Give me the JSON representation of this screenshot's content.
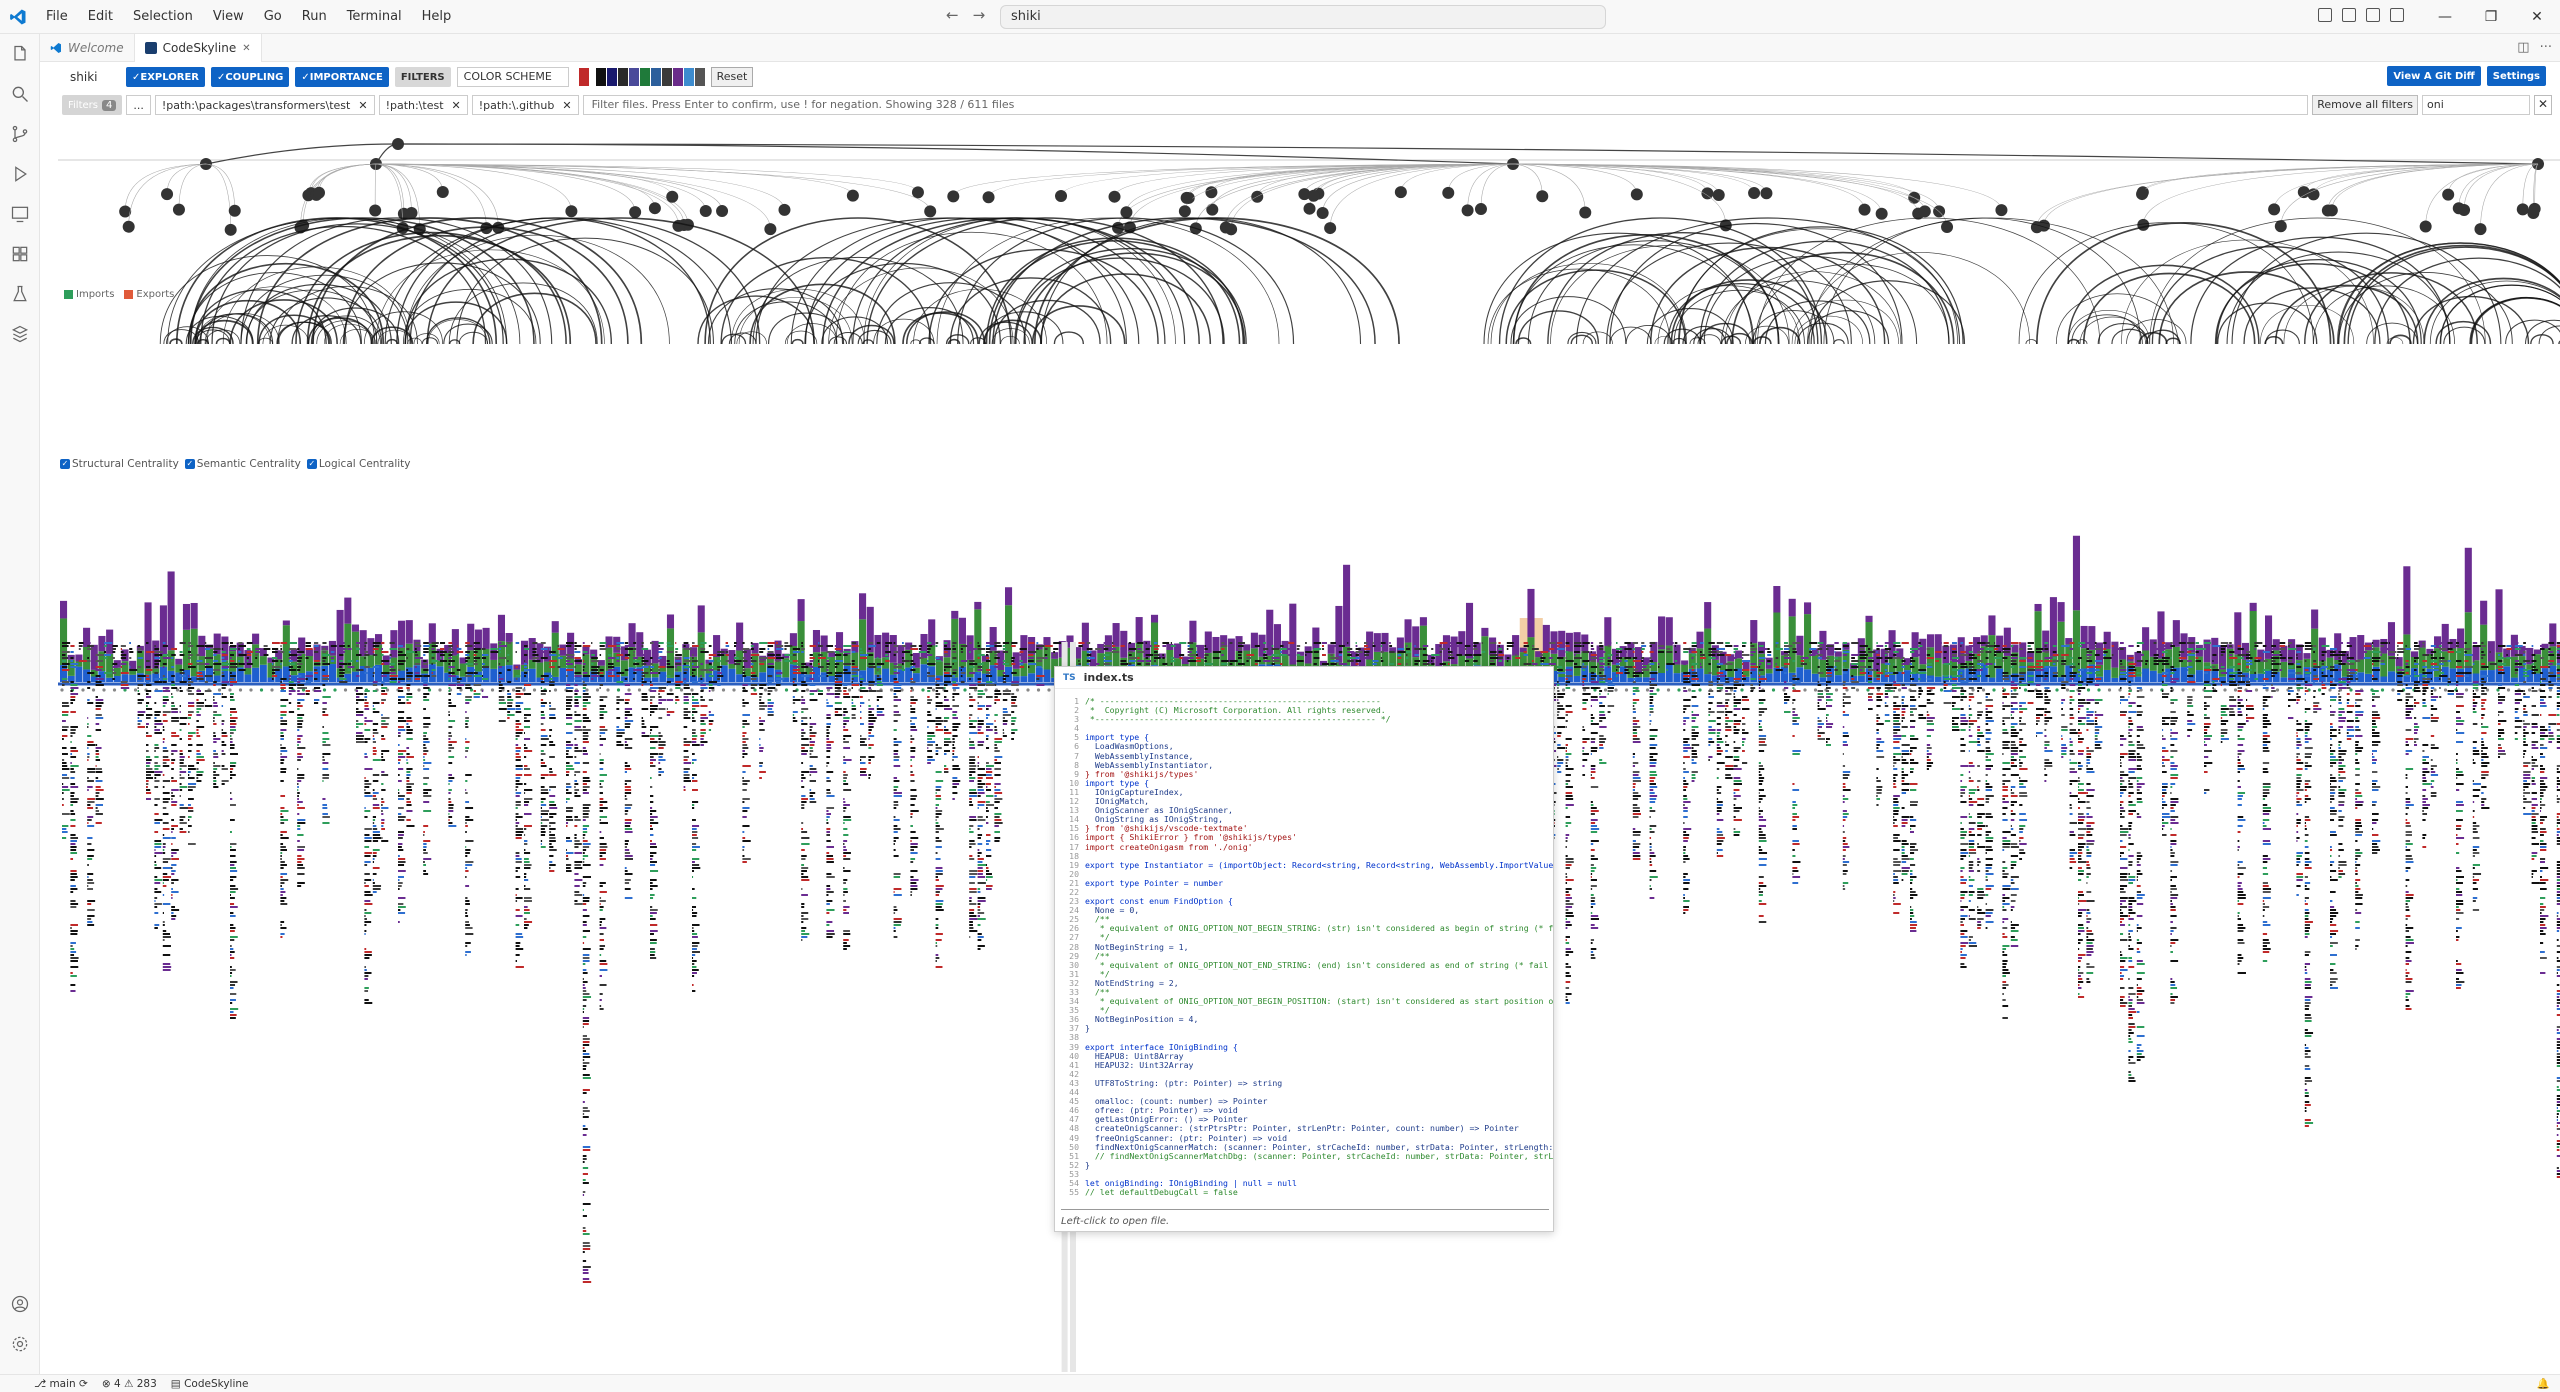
{
  "titlebar": {
    "menu": [
      "File",
      "Edit",
      "Selection",
      "View",
      "Go",
      "Run",
      "Terminal",
      "Help"
    ],
    "command_center": "shiki",
    "nav_back": "←",
    "nav_forward": "→",
    "win_minimize": "—",
    "win_restore": "❐",
    "win_close": "✕"
  },
  "tabs": [
    {
      "label": "Welcome",
      "state": "inactive"
    },
    {
      "label": "CodeSkyline",
      "state": "active",
      "close": "✕"
    }
  ],
  "tab_actions": {
    "split": "◫",
    "more": "···"
  },
  "toolbar": {
    "repo": "shiki",
    "explorer": "✓EXPLORER",
    "coupling": "✓COUPLING",
    "importance": "✓IMPORTANCE",
    "filters_btn": "FILTERS",
    "color_scheme": "COLOR SCHEME",
    "reset": "Reset",
    "git_diff": "View A Git Diff",
    "settings": "Settings",
    "swatches": [
      "#c02a2a",
      "#111111",
      "#1a1a6e",
      "#2a2a2a",
      "#4a4a9a",
      "#1f7a3a",
      "#2c5f9c",
      "#3a3a3a",
      "#6a2c8a",
      "#3d8ccf",
      "#555555"
    ]
  },
  "filterbar": {
    "filters_label": "Filters",
    "filters_count": "4",
    "ellipsis": "...",
    "chips": [
      {
        "label": "!path:\\packages\\transformers\\test",
        "close": "✕"
      },
      {
        "label": "!path:\\test",
        "close": "✕"
      },
      {
        "label": "!path:\\.github",
        "close": "✕"
      }
    ],
    "input_placeholder": "Filter files. Press Enter to confirm, use ! for negation. Showing 328 / 611 files",
    "remove_all": "Remove all filters",
    "search_value": "oni",
    "clear": "✕"
  },
  "legend_io": {
    "imports": "Imports",
    "imports_color": "#2e9e5b",
    "exports": "Exports",
    "exports_color": "#e05a3a"
  },
  "centrality_legend": {
    "structural": "Structural Centrality",
    "semantic": "Semantic Centrality",
    "logical": "Logical Centrality",
    "check": "✓"
  },
  "colors": {
    "structural": "#1f5fcf",
    "semantic": "#3a8f3a",
    "logical": "#6a2c91",
    "highlight": "#f3cfa6",
    "accent": "#0e63c5"
  },
  "popup": {
    "filename": "index.ts",
    "footer": "Left-click to open file.",
    "lines": [
      {
        "n": "1",
        "t": "/* ---------------------------------------------------------",
        "c": "cm"
      },
      {
        "n": "2",
        "t": " *  Copyright (C) Microsoft Corporation. All rights reserved.",
        "c": "cm"
      },
      {
        "n": "3",
        "t": " *--------------------------------------------------------- */",
        "c": "cm"
      },
      {
        "n": "4",
        "t": "",
        "c": ""
      },
      {
        "n": "5",
        "t": "import type {",
        "c": "kw"
      },
      {
        "n": "6",
        "t": "  LoadWasmOptions,",
        "c": ""
      },
      {
        "n": "7",
        "t": "  WebAssemblyInstance,",
        "c": ""
      },
      {
        "n": "8",
        "t": "  WebAssemblyInstantiator,",
        "c": ""
      },
      {
        "n": "9",
        "t": "} from '@shikijs/types'",
        "c": "str"
      },
      {
        "n": "10",
        "t": "import type {",
        "c": "kw"
      },
      {
        "n": "11",
        "t": "  IOnigCaptureIndex,",
        "c": ""
      },
      {
        "n": "12",
        "t": "  IOnigMatch,",
        "c": ""
      },
      {
        "n": "13",
        "t": "  OnigScanner as IOnigScanner,",
        "c": ""
      },
      {
        "n": "14",
        "t": "  OnigString as IOnigString,",
        "c": ""
      },
      {
        "n": "15",
        "t": "} from '@shikijs/vscode-textmate'",
        "c": "str"
      },
      {
        "n": "16",
        "t": "import { ShikiError } from '@shikijs/types'",
        "c": "str"
      },
      {
        "n": "17",
        "t": "import createOnigasm from './onig'",
        "c": "str"
      },
      {
        "n": "18",
        "t": "",
        "c": ""
      },
      {
        "n": "19",
        "t": "export type Instantiator = (importObject: Record<string, Record<string, WebAssembly.ImportValue>>) => Promise<WebAssemblyInstance>",
        "c": "kw"
      },
      {
        "n": "20",
        "t": "",
        "c": ""
      },
      {
        "n": "21",
        "t": "export type Pointer = number",
        "c": "kw"
      },
      {
        "n": "22",
        "t": "",
        "c": ""
      },
      {
        "n": "23",
        "t": "export const enum FindOption {",
        "c": "kw"
      },
      {
        "n": "24",
        "t": "  None = 0,",
        "c": ""
      },
      {
        "n": "25",
        "t": "  /**",
        "c": "cm"
      },
      {
        "n": "26",
        "t": "   * equivalent of ONIG_OPTION_NOT_BEGIN_STRING: (str) isn't considered as begin of string (* fail \\A)",
        "c": "cm"
      },
      {
        "n": "27",
        "t": "   */",
        "c": "cm"
      },
      {
        "n": "28",
        "t": "  NotBeginString = 1,",
        "c": ""
      },
      {
        "n": "29",
        "t": "  /**",
        "c": "cm"
      },
      {
        "n": "30",
        "t": "   * equivalent of ONIG_OPTION_NOT_END_STRING: (end) isn't considered as end of string (* fail \\z, \\Z)",
        "c": "cm"
      },
      {
        "n": "31",
        "t": "   */",
        "c": "cm"
      },
      {
        "n": "32",
        "t": "  NotEndString = 2,",
        "c": ""
      },
      {
        "n": "33",
        "t": "  /**",
        "c": "cm"
      },
      {
        "n": "34",
        "t": "   * equivalent of ONIG_OPTION_NOT_BEGIN_POSITION: (start) isn't considered as start position of search (* fail \\G)",
        "c": "cm"
      },
      {
        "n": "35",
        "t": "   */",
        "c": "cm"
      },
      {
        "n": "36",
        "t": "  NotBeginPosition = 4,",
        "c": ""
      },
      {
        "n": "37",
        "t": "}",
        "c": ""
      },
      {
        "n": "38",
        "t": "",
        "c": ""
      },
      {
        "n": "39",
        "t": "export interface IOnigBinding {",
        "c": "kw"
      },
      {
        "n": "40",
        "t": "  HEAPU8: Uint8Array",
        "c": ""
      },
      {
        "n": "41",
        "t": "  HEAPU32: Uint32Array",
        "c": ""
      },
      {
        "n": "42",
        "t": "",
        "c": ""
      },
      {
        "n": "43",
        "t": "  UTF8ToString: (ptr: Pointer) => string",
        "c": ""
      },
      {
        "n": "44",
        "t": "",
        "c": ""
      },
      {
        "n": "45",
        "t": "  omalloc: (count: number) => Pointer",
        "c": ""
      },
      {
        "n": "46",
        "t": "  ofree: (ptr: Pointer) => void",
        "c": ""
      },
      {
        "n": "47",
        "t": "  getLastOnigError: () => Pointer",
        "c": ""
      },
      {
        "n": "48",
        "t": "  createOnigScanner: (strPtrsPtr: Pointer, strLenPtr: Pointer, count: number) => Pointer",
        "c": ""
      },
      {
        "n": "49",
        "t": "  freeOnigScanner: (ptr: Pointer) => void",
        "c": ""
      },
      {
        "n": "50",
        "t": "  findNextOnigScannerMatch: (scanner: Pointer, strCacheId: number, strData: Pointer, strLength: number, position: number, options: number) => number",
        "c": ""
      },
      {
        "n": "51",
        "t": "  // findNextOnigScannerMatchDbg: (scanner: Pointer, strCacheId: number, strData: Pointer, strLength: number, position: number, options: number) => number",
        "c": "cm"
      },
      {
        "n": "52",
        "t": "}",
        "c": ""
      },
      {
        "n": "53",
        "t": "",
        "c": ""
      },
      {
        "n": "54",
        "t": "let onigBinding: IOnigBinding | null = null",
        "c": "kw"
      },
      {
        "n": "55",
        "t": "// let defaultDebugCall = false",
        "c": "cm"
      }
    ]
  },
  "statusbar": {
    "branch": "main",
    "problems": "⊗ 4 ⚠ 283",
    "extension": "CodeSkyline"
  }
}
